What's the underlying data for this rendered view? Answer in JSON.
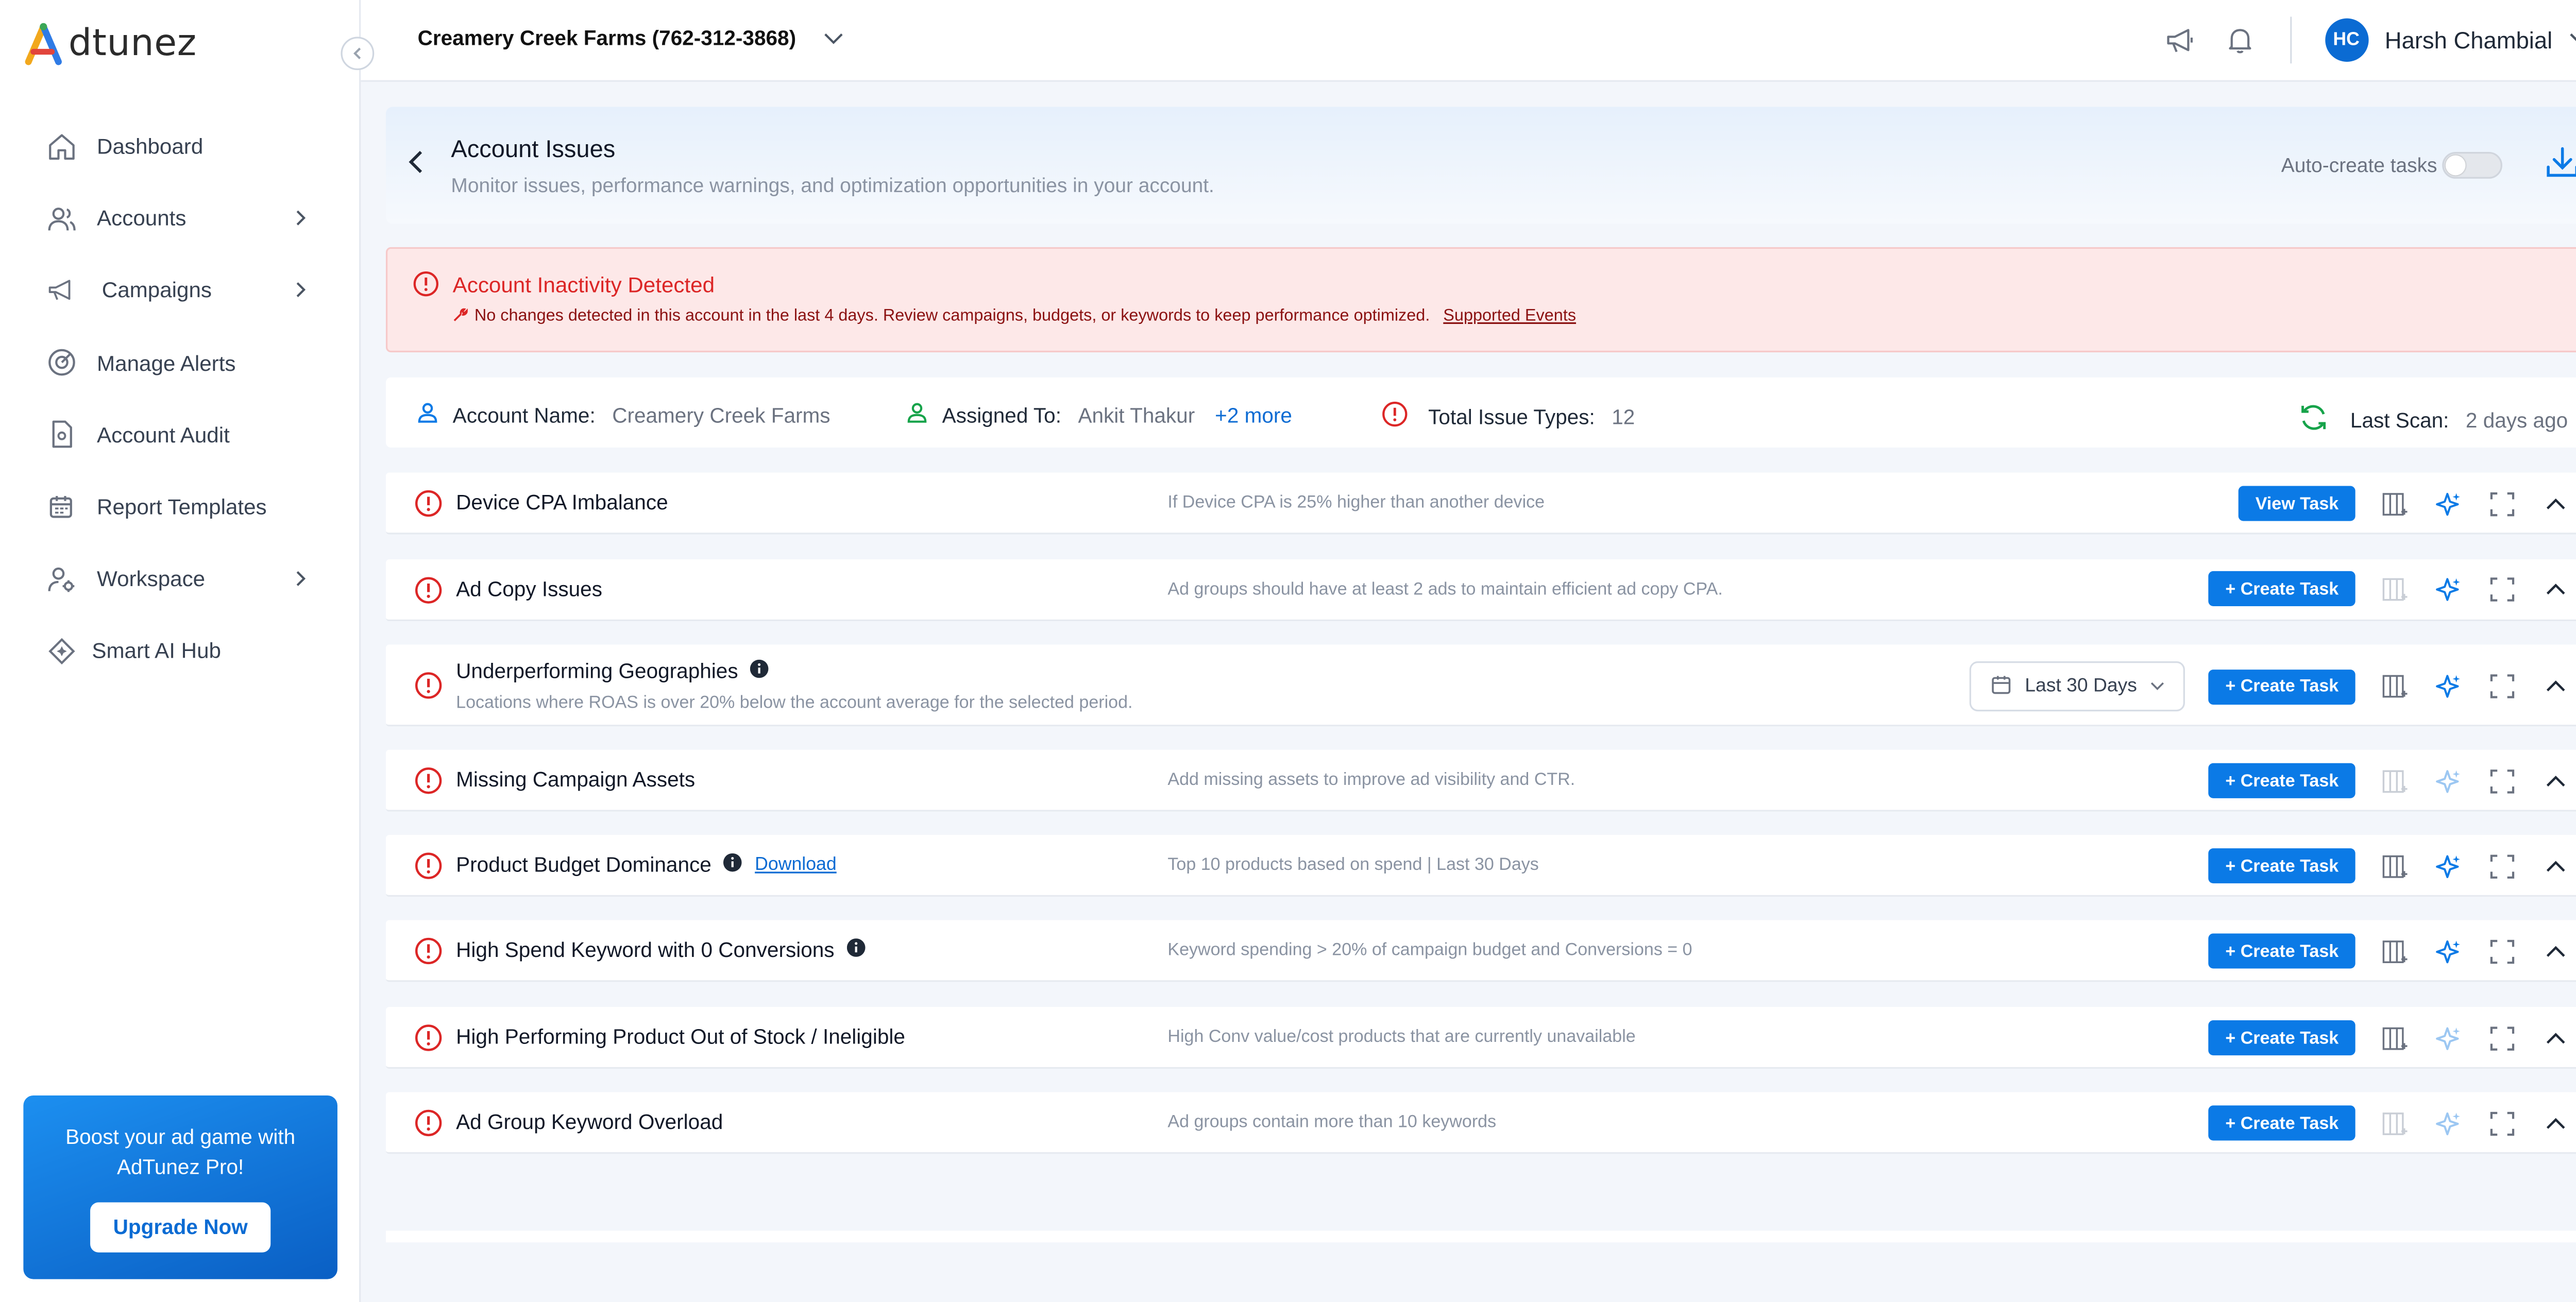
{
  "app": {
    "logo_text": "dtunez"
  },
  "topbar": {
    "account_selector": "Creamery Creek Farms (762-312-3868)",
    "user_initials": "HC",
    "user_name": "Harsh Chambial"
  },
  "sidebar": {
    "items": [
      {
        "label": "Dashboard",
        "icon": "home-icon"
      },
      {
        "label": "Accounts",
        "icon": "users-icon"
      },
      {
        "label": "Campaigns",
        "icon": "megaphone-icon"
      },
      {
        "label": "Manage Alerts",
        "icon": "target-icon"
      },
      {
        "label": "Account Audit",
        "icon": "document-icon"
      },
      {
        "label": "Report Templates",
        "icon": "calendar-icon"
      },
      {
        "label": "Workspace",
        "icon": "user-gear-icon"
      },
      {
        "label": "Smart AI Hub",
        "icon": "sparkle-diamond-icon"
      }
    ],
    "promo_text": "Boost your ad game with AdTunez Pro!",
    "promo_button": "Upgrade Now"
  },
  "header": {
    "title": "Account Issues",
    "subtitle": "Monitor issues, performance warnings, and optimization opportunities in your account.",
    "auto_create_label": "Auto-create tasks",
    "auto_create_on": false
  },
  "alert": {
    "title": "Account Inactivity Detected",
    "body": "No changes detected in this account in the last 4 days. Review campaigns, budgets, or keywords to keep performance optimized.",
    "link": "Supported Events"
  },
  "info": {
    "account_name_label": "Account Name:",
    "account_name": "Creamery Creek Farms",
    "assigned_label": "Assigned To:",
    "assigned": "Ankit Thakur",
    "assigned_more": "+2 more",
    "issue_types_label": "Total Issue Types:",
    "issue_types": "12",
    "last_scan_label": "Last Scan:",
    "last_scan": "2 days ago"
  },
  "issues": [
    {
      "name": "Device CPA Imbalance",
      "desc": "If Device CPA is 25% higher than another device",
      "button": "View Task"
    },
    {
      "name": "Ad Copy Issues",
      "desc": "Ad groups should have at least 2 ads to maintain efficient ad copy CPA.",
      "button": "+ Create Task"
    },
    {
      "name": "Underperforming Geographies",
      "sub": "Locations where ROAS is over 20% below the account average for the selected period.",
      "date_range": "Last 30 Days",
      "button": "+ Create Task"
    },
    {
      "name": "Missing Campaign Assets",
      "desc": "Add missing assets to improve ad visibility and CTR.",
      "button": "+ Create Task"
    },
    {
      "name": "Product Budget Dominance",
      "link": "Download",
      "desc": "Top 10 products based on spend | Last 30 Days",
      "button": "+ Create Task"
    },
    {
      "name": "High Spend Keyword with 0 Conversions",
      "desc": "Keyword spending > 20% of campaign budget and Conversions = 0",
      "button": "+ Create Task"
    },
    {
      "name": "High Performing Product Out of Stock / Ineligible",
      "desc": "High Conv value/cost products that are currently unavailable",
      "button": "+ Create Task"
    },
    {
      "name": "Ad Group Keyword Overload",
      "desc": "Ad groups contain more than 10 keywords",
      "button": "+ Create Task"
    }
  ],
  "colors": {
    "primary": "#0b7ae6",
    "alert_red": "#dc2626",
    "alert_bg": "#fde8e8"
  }
}
